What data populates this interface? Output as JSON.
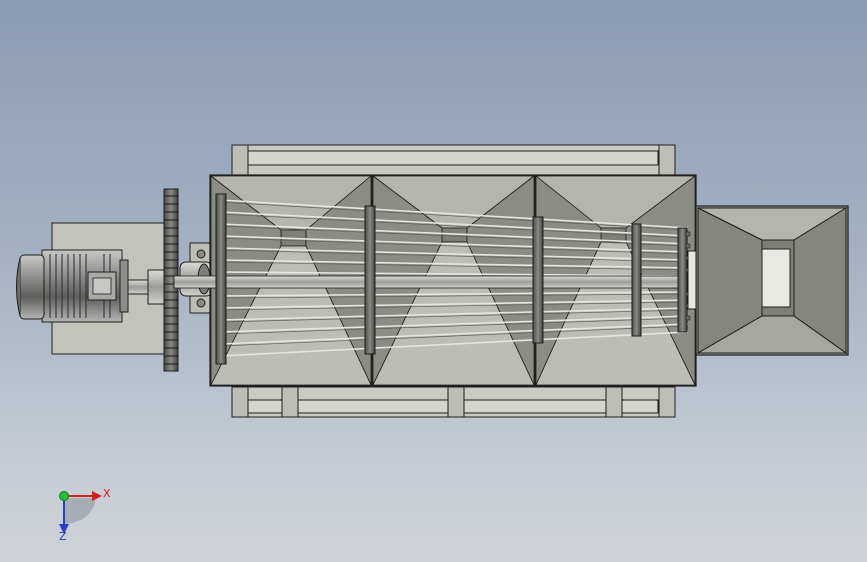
{
  "triad": {
    "x_label": "X",
    "z_label": "Z",
    "x_color": "#d42020",
    "y_color": "#1fbf3a",
    "z_color": "#2a3fc8"
  },
  "palette": {
    "background_top": "#8a9cb4",
    "background_bottom": "#cfd3d7",
    "frame_fill": "#c9cac2",
    "part_fill": "#b8b9b1",
    "edge": "#1e1e1e",
    "hopper_dark": "#7e8078",
    "hopper_mid": "#9a9b93",
    "hopper_light": "#b4b5ad"
  }
}
